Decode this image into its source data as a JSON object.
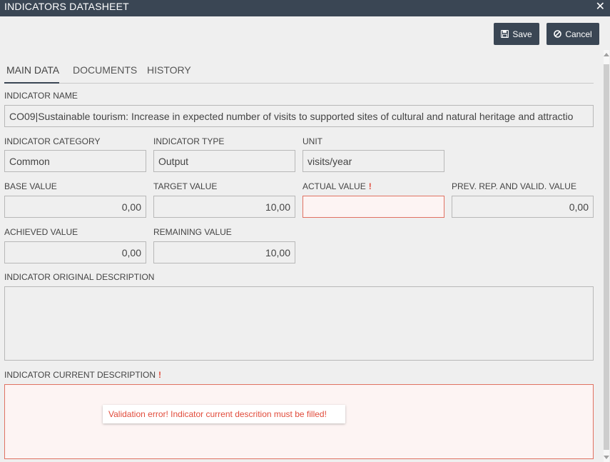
{
  "window": {
    "title": "INDICATORS DATASHEET",
    "close_glyph": "✕"
  },
  "toolbar": {
    "save_label": "Save",
    "cancel_label": "Cancel"
  },
  "tabs": [
    {
      "label": "MAIN DATA",
      "active": true
    },
    {
      "label": "DOCUMENTS",
      "active": false
    },
    {
      "label": "HISTORY",
      "active": false
    }
  ],
  "form": {
    "indicator_name": {
      "label": "INDICATOR NAME",
      "value": "CO09|Sustainable tourism: Increase in expected number of visits to supported sites of cultural and natural heritage and attractio"
    },
    "indicator_category": {
      "label": "INDICATOR CATEGORY",
      "value": "Common"
    },
    "indicator_type": {
      "label": "INDICATOR TYPE",
      "value": "Output"
    },
    "unit": {
      "label": "UNIT",
      "value": "visits/year"
    },
    "base_value": {
      "label": "BASE VALUE",
      "value": "0,00"
    },
    "target_value": {
      "label": "TARGET VALUE",
      "value": "10,00"
    },
    "actual_value": {
      "label": "ACTUAL VALUE",
      "value": "",
      "required_mark": "!"
    },
    "prev_rep_value": {
      "label": "PREV. REP. AND VALID. VALUE",
      "value": "0,00"
    },
    "achieved_value": {
      "label": "ACHIEVED VALUE",
      "value": "0,00"
    },
    "remaining_value": {
      "label": "REMAINING VALUE",
      "value": "10,00"
    },
    "original_description": {
      "label": "INDICATOR ORIGINAL DESCRIPTION",
      "value": ""
    },
    "current_description": {
      "label": "INDICATOR CURRENT DESCRIPTION",
      "value": "",
      "required_mark": "!"
    }
  },
  "validation": {
    "message": "Validation error! Indicator current descrition must be filled!"
  },
  "colors": {
    "header_bg": "#3a4654",
    "error": "#e14b3b",
    "field_bg": "#efefef",
    "page_bg": "#efefef"
  },
  "icons": {
    "save": "floppy-disk-icon",
    "cancel": "ban-icon",
    "close": "close-icon"
  }
}
